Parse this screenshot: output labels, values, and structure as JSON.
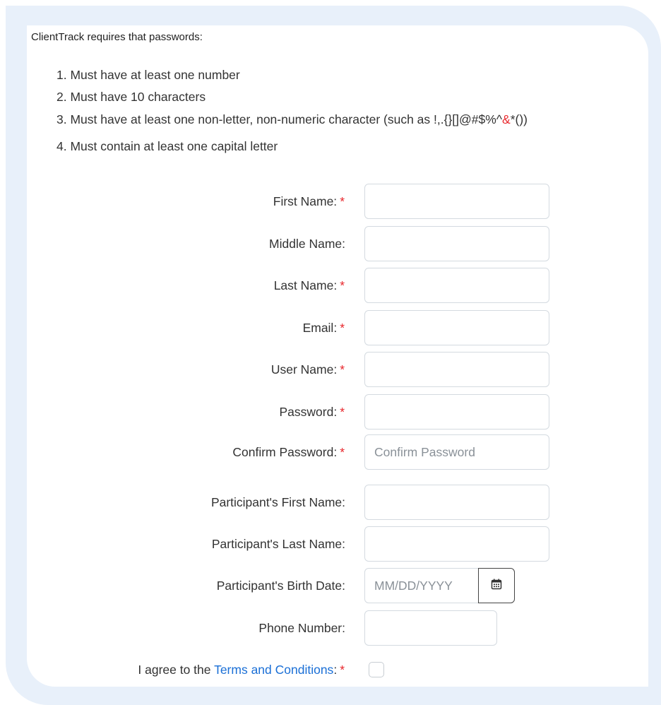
{
  "intro": "ClientTrack requires that passwords:",
  "rules": [
    "1. Must have at least one number",
    "2. Must have 10 characters",
    "3. Must have at least one non-letter, non-numeric character (such as !,.{}[]@#$%^",
    "4. Must contain at least one capital letter"
  ],
  "rule3_amp": "&",
  "rule3_tail": "*())",
  "required_mark": "*",
  "fields": {
    "first_name": "First Name:",
    "middle_name": "Middle Name:",
    "last_name": "Last Name:",
    "email": "Email:",
    "user_name": "User Name:",
    "password": "Password:",
    "confirm_password": "Confirm Password:",
    "confirm_password_placeholder": "Confirm Password",
    "participant_first": "Participant's First Name:",
    "participant_last": "Participant's Last Name:",
    "participant_birth": "Participant's Birth Date:",
    "birth_placeholder": "MM/DD/YYYY",
    "phone": "Phone Number:"
  },
  "terms": {
    "prefix": "I agree to the ",
    "link": "Terms and Conditions",
    "suffix": ":"
  },
  "icons": {
    "calendar": "calendar-icon"
  },
  "colors": {
    "required": "#e8262b",
    "link": "#1a6fd6",
    "frame": "#e8f0fa"
  }
}
